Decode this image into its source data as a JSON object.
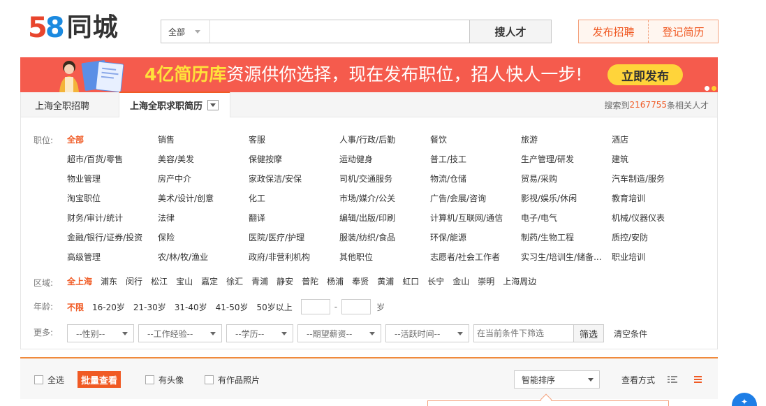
{
  "header": {
    "logo_num_1": "5",
    "logo_num_2": "8",
    "logo_text": "同城",
    "search_category": "全部",
    "search_placeholder": "",
    "search_button": "搜人才",
    "post_job": "发布招聘",
    "register_resume": "登记简历"
  },
  "banner": {
    "highlight": "4亿简历库",
    "text": "资源供你选择，现在发布职位，招人快人一步!",
    "button": "立即发布"
  },
  "tabs": {
    "tab1": "上海全职招聘",
    "tab2": "上海全职求职简历",
    "result_prefix": "搜索到",
    "result_count": "2167755",
    "result_suffix": "条相关人才"
  },
  "filters": {
    "position_label": "职位:",
    "positions": [
      "全部",
      "销售",
      "客服",
      "人事/行政/后勤",
      "餐饮",
      "旅游",
      "酒店",
      "超市/百货/零售",
      "美容/美发",
      "保健按摩",
      "运动健身",
      "普工/技工",
      "生产管理/研发",
      "建筑",
      "物业管理",
      "房产中介",
      "家政保洁/安保",
      "司机/交通服务",
      "物流/仓储",
      "贸易/采购",
      "汽车制造/服务",
      "淘宝职位",
      "美术/设计/创意",
      "化工",
      "市场/媒介/公关",
      "广告/会展/咨询",
      "影视/娱乐/休闲",
      "教育培训",
      "财务/审计/统计",
      "法律",
      "翻译",
      "编辑/出版/印刷",
      "计算机/互联网/通信",
      "电子/电气",
      "机械/仪器仪表",
      "金融/银行/证券/投资",
      "保险",
      "医院/医疗/护理",
      "服装/纺织/食品",
      "环保/能源",
      "制药/生物工程",
      "质控/安防",
      "高级管理",
      "农/林/牧/渔业",
      "政府/非营利机构",
      "其他职位",
      "志愿者/社会工作者",
      "实习生/培训生/储备...",
      "职业培训"
    ],
    "area_label": "区域:",
    "areas": [
      "全上海",
      "浦东",
      "闵行",
      "松江",
      "宝山",
      "嘉定",
      "徐汇",
      "青浦",
      "静安",
      "普陀",
      "杨浦",
      "奉贤",
      "黄浦",
      "虹口",
      "长宁",
      "金山",
      "崇明",
      "上海周边"
    ],
    "age_label": "年龄:",
    "ages": [
      "不限",
      "16-20岁",
      "21-30岁",
      "31-40岁",
      "41-50岁",
      "50岁以上"
    ],
    "age_sep": "-",
    "age_unit": "岁",
    "more_label": "更多:",
    "selects": [
      "--性别--",
      "--工作经验--",
      "--学历--",
      "--期望薪资--",
      "--活跃时间--"
    ],
    "condition_placeholder": "在当前条件下筛选",
    "filter_button": "筛选",
    "clear_button": "清空条件"
  },
  "list_bar": {
    "select_all": "全选",
    "batch_view": "批量查看",
    "has_avatar": "有头像",
    "has_works": "有作品照片",
    "sort": "智能排序",
    "view_mode": "查看方式"
  },
  "colors": {
    "accent": "#f05a24",
    "banner_bg": "#f55b4d",
    "banner_highlight": "#ffe13b",
    "banner_button": "#ffd43a"
  }
}
